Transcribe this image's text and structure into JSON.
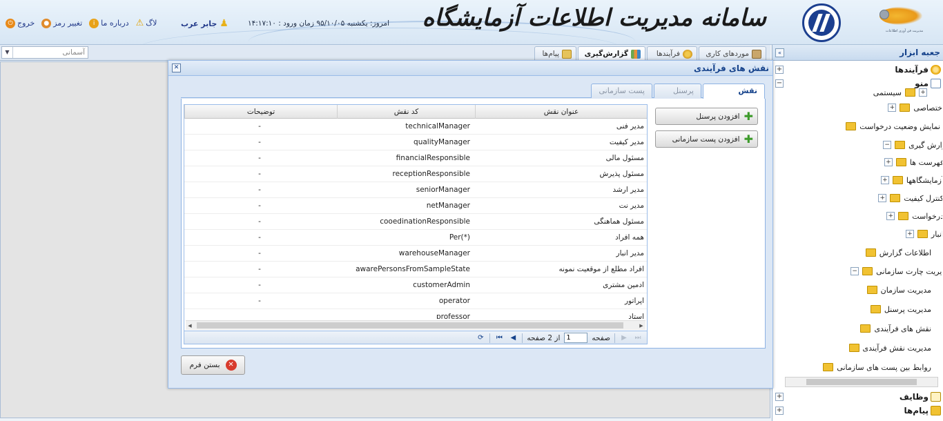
{
  "header": {
    "system_title": "سامانه مدیریت اطلاعات آزمایشگاه",
    "logo_caption": "مدیریت فن آوری اطلاعات",
    "date_text": "امروز: یکشنبه ۹۵/۱۰/۰۵  زمان ورود : ۱۴:۱۷:۱۰",
    "user_name": "جابر عرب",
    "links": {
      "log": "لاگ",
      "about": "درباره ما",
      "change_password": "تغییر رمز",
      "exit": "خروج"
    }
  },
  "tabbar": {
    "theme_select": "آسمانی",
    "tabs": [
      {
        "label": "موردهای کاری",
        "icon": "desk-icon"
      },
      {
        "label": "فرآیندها",
        "icon": "gear-icon"
      },
      {
        "label": "گزارش‌گیری",
        "icon": "chart-icon"
      },
      {
        "label": "پیام‌ها",
        "icon": "mail-icon"
      }
    ]
  },
  "sidebar": {
    "title": "جعبه ابزار",
    "processes": "فرآیندها",
    "menu": "منو",
    "tasks": "وظایف",
    "messages": "پیام‌ها",
    "tree": [
      {
        "label": "سیستمی"
      },
      {
        "label": "اختصاصی"
      },
      {
        "label": "نمایش وضعیت درخواست"
      },
      {
        "label": "گزارش گیری"
      },
      {
        "label": "فهرست ها"
      },
      {
        "label": "آزمایشگاهها"
      },
      {
        "label": "کنترل کیفیت"
      },
      {
        "label": "درخواست"
      },
      {
        "label": "انبار"
      },
      {
        "label": "اطلاعات گزارش"
      },
      {
        "label": "مدیریت چارت سازمانی"
      },
      {
        "label": "مدیریت سازمان"
      },
      {
        "label": "مدیریت پرسنل"
      },
      {
        "label": "نقش های فرآیندی"
      },
      {
        "label": "مدیریت نقش فرآیندی"
      },
      {
        "label": "روابط بین پست های سازمانی"
      }
    ]
  },
  "modal": {
    "title": "نقش های فرآیندی",
    "tabs": {
      "process_role": "نقش فرآیندی",
      "personnel": "پرسنل",
      "org_post": "پست سازمانی"
    },
    "add_personnel": "افزودن پرسنل",
    "add_org_post": "افزودن پست سازمانی",
    "columns": {
      "title": "عنوان نقش",
      "code": "کد نقش",
      "desc": "توضیحات"
    },
    "rows": [
      {
        "title": "مدیر فنی",
        "code": "technicalManager",
        "desc": "-"
      },
      {
        "title": "مدیر کیفیت",
        "code": "qualityManager",
        "desc": "-"
      },
      {
        "title": "مسئول مالی",
        "code": "financialResponsible",
        "desc": "-"
      },
      {
        "title": "مسئول پذیرش",
        "code": "receptionResponsible",
        "desc": "-"
      },
      {
        "title": "مدیر ارشد",
        "code": "seniorManager",
        "desc": "-"
      },
      {
        "title": "مدیر نت",
        "code": "netManager",
        "desc": "-"
      },
      {
        "title": "مسئول هماهنگی",
        "code": "cooedinationResponsible",
        "desc": "-"
      },
      {
        "title": "همه افراد",
        "code": "Per(*)",
        "desc": "-"
      },
      {
        "title": "مدیر انبار",
        "code": "warehouseManager",
        "desc": "-"
      },
      {
        "title": "افراد مطلع از موقعیت نمونه",
        "code": "awarePersonsFromSampleState",
        "desc": "-"
      },
      {
        "title": "ادمین مشتری",
        "code": "customerAdmin",
        "desc": "-"
      },
      {
        "title": "اپراتور",
        "code": "operator",
        "desc": "-"
      },
      {
        "title": "استاد",
        "code": "professor",
        "desc": ""
      }
    ],
    "pager": {
      "page_label": "صفحه",
      "page_value": "1",
      "of_pages": "از 2 صفحه"
    },
    "close_form": "بستن فرم"
  }
}
